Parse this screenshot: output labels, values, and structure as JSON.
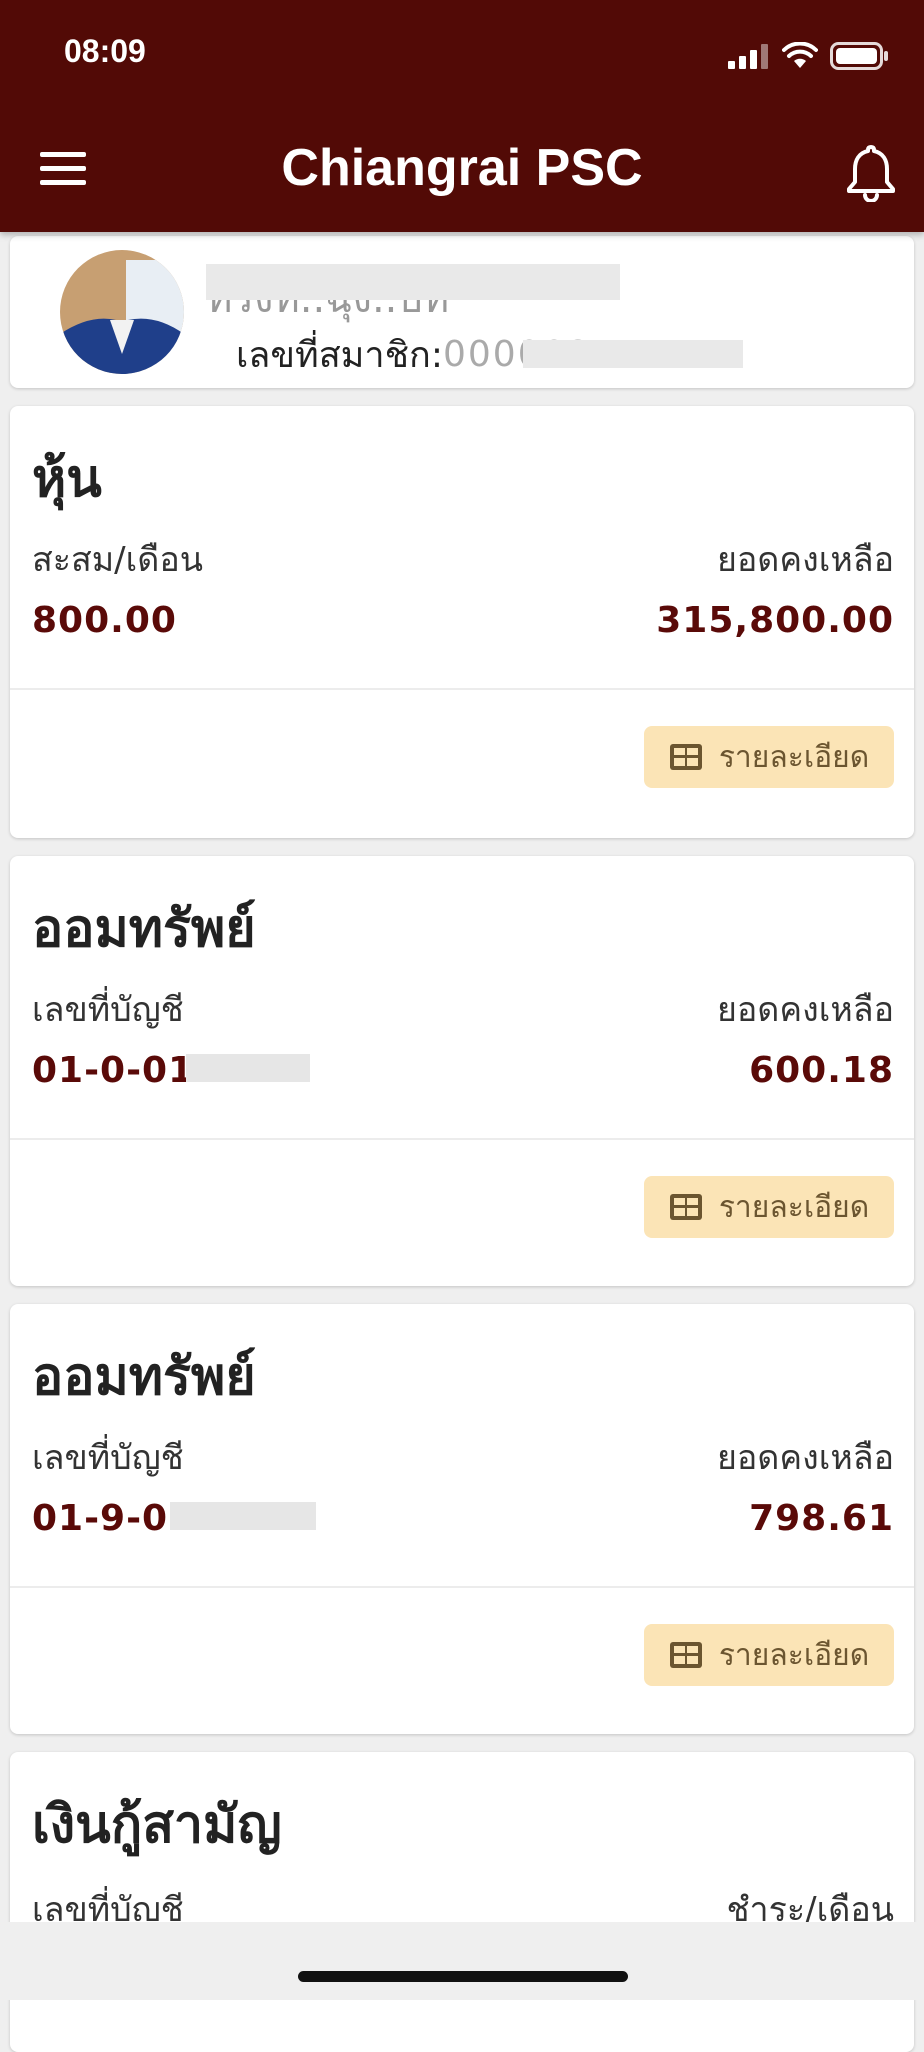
{
  "status_bar": {
    "time": "08:09"
  },
  "header": {
    "title": "Chiangrai PSC"
  },
  "profile": {
    "name_fragment": "ทรงท..ฉุง..บท",
    "member_label": "เลขที่สมาชิก:",
    "member_fragment": "00000211"
  },
  "cards": [
    {
      "title": "หุ้น",
      "left_label": "สะสม/เดือน",
      "right_label": "ยอดคงเหลือ",
      "left_value": "800.00",
      "right_value": "315,800.00",
      "button_label": "รายละเอียด"
    },
    {
      "title": "ออมทรัพย์",
      "left_label": "เลขที่บัญชี",
      "right_label": "ยอดคงเหลือ",
      "left_value": "01-0-01",
      "right_value": "600.18",
      "button_label": "รายละเอียด"
    },
    {
      "title": "ออมทรัพย์",
      "left_label": "เลขที่บัญชี",
      "right_label": "ยอดคงเหลือ",
      "left_value": "01-9-0",
      "right_value": "798.61",
      "button_label": "รายละเอียด"
    },
    {
      "title": "เงินกู้สามัญ",
      "left_label": "เลขที่บัญชี",
      "right_label": "ชำระ/เดือน"
    }
  ],
  "colors": {
    "header_bg": "#520a06",
    "value_text": "#5a0a08",
    "button_bg": "#fbe4b6",
    "button_text": "#6b5530"
  }
}
